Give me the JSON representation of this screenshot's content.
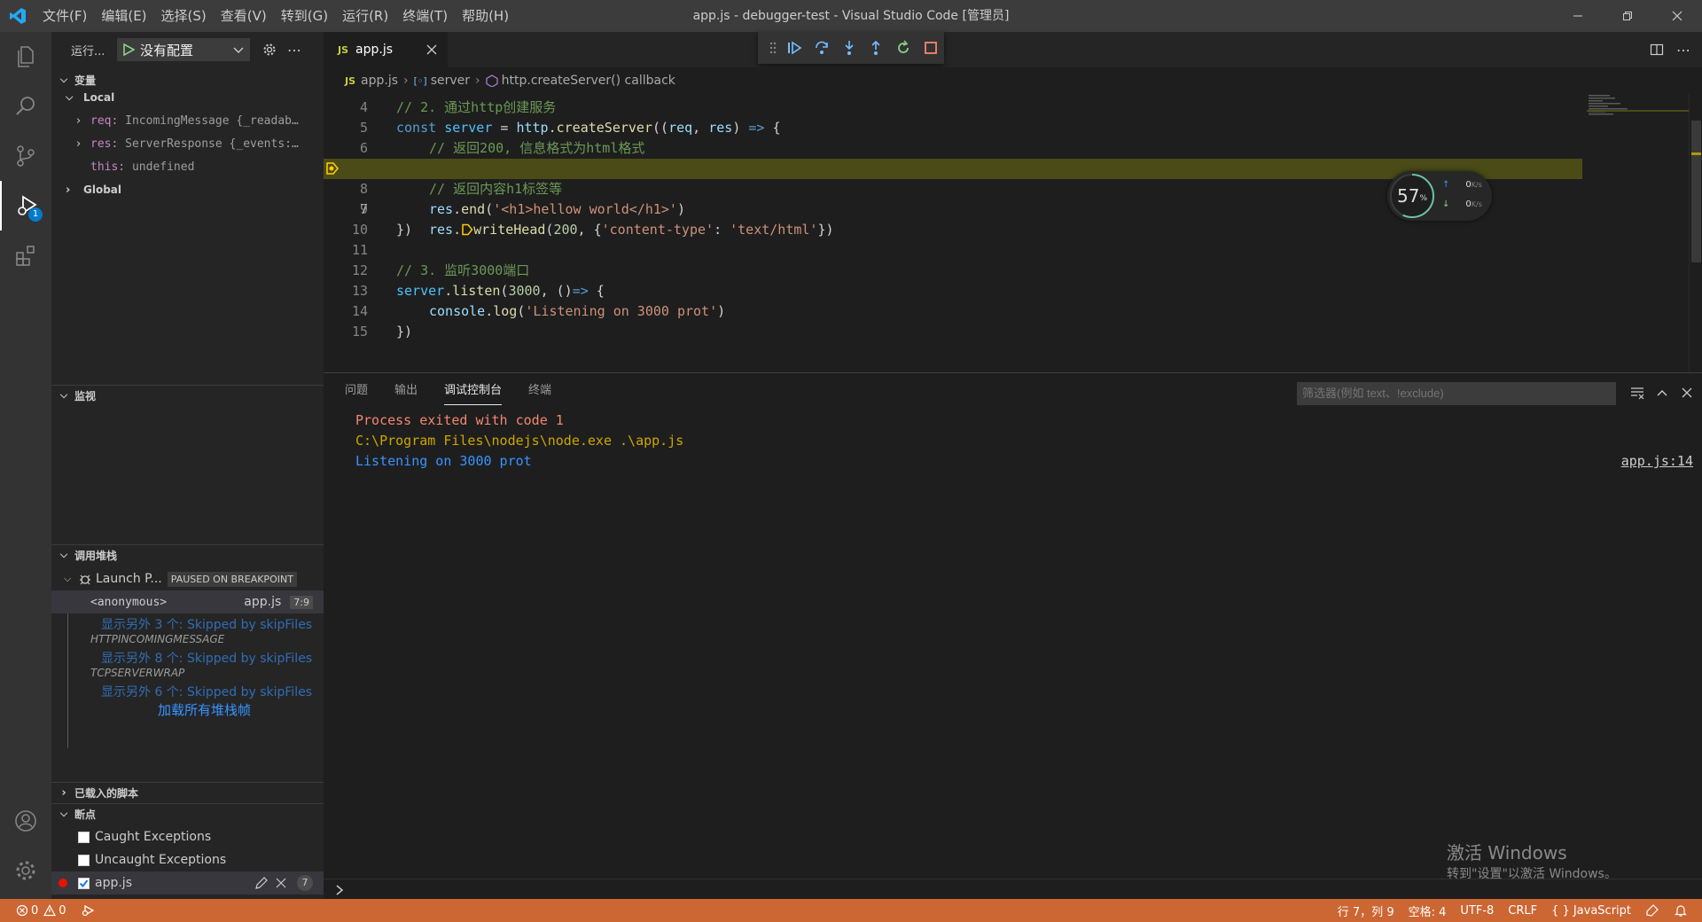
{
  "titlebar": {
    "title": "app.js - debugger-test - Visual Studio Code [管理员]",
    "menus": [
      "文件(F)",
      "编辑(E)",
      "选择(S)",
      "查看(V)",
      "转到(G)",
      "运行(R)",
      "终端(T)",
      "帮助(H)"
    ]
  },
  "activity": {
    "debug_badge": "1"
  },
  "sidebar": {
    "run_label": "运行...",
    "config_name": "没有配置",
    "variables": {
      "header": "变量",
      "local_header": "Local",
      "items": [
        {
          "name": "req:",
          "value": "IncomingMessage {_readab…"
        },
        {
          "name": "res:",
          "value": "ServerResponse {_events:…"
        },
        {
          "name": "this:",
          "value": "undefined"
        }
      ],
      "global_header": "Global"
    },
    "watch": {
      "header": "监视"
    },
    "callstack": {
      "header": "调用堆栈",
      "session": "Launch P...",
      "session_state": "PAUSED ON BREAKPOINT",
      "frame": {
        "name": "<anonymous>",
        "file": "app.js",
        "pos": "7:9"
      },
      "skipped": [
        {
          "text": "显示另外 3 个: Skipped by skipFiles",
          "name": "HTTPINCOMINGMESSAGE"
        },
        {
          "text": "显示另外 8 个: Skipped by skipFiles",
          "name": "TCPSERVERWRAP"
        },
        {
          "text": "显示另外 6 个: Skipped by skipFiles",
          "name": ""
        }
      ],
      "load_all": "加载所有堆栈帧"
    },
    "loaded_scripts": {
      "header": "已载入的脚本"
    },
    "breakpoints": {
      "header": "断点",
      "items": [
        {
          "label": "Caught Exceptions",
          "checked": false
        },
        {
          "label": "Uncaught Exceptions",
          "checked": false
        }
      ],
      "file": {
        "label": "app.js",
        "line": "7"
      }
    }
  },
  "editor": {
    "tab_icon": "JS",
    "tab_label": "app.js",
    "breadcrumb": [
      "app.js",
      "server",
      "http.createServer() callback"
    ],
    "lines": [
      {
        "n": "4"
      },
      {
        "n": "5"
      },
      {
        "n": "6"
      },
      {
        "n": "7"
      },
      {
        "n": "8"
      },
      {
        "n": "9"
      },
      {
        "n": "10"
      },
      {
        "n": "11"
      },
      {
        "n": "12"
      },
      {
        "n": "13"
      },
      {
        "n": "14"
      },
      {
        "n": "15"
      }
    ],
    "code": {
      "l4": "// 2. 通过http创建服务",
      "l5_kw": "const",
      "l5_var": "server",
      "l5_eq": " = ",
      "l5_obj": "http",
      "l5_fn": "createServer",
      "l5_rest1": "((",
      "l5_a1": "req",
      "l5_c": ", ",
      "l5_a2": "res",
      "l5_rest2": ") ",
      "l5_arrow": "=>",
      "l5_rest3": " {",
      "l6": "// 返回200, 信息格式为html格式",
      "l7_obj": "res",
      "l7_dot": ".",
      "l7_fn": "writeHead",
      "l7_p1": "(",
      "l7_num": "200",
      "l7_p2": ", {",
      "l7_s1": "'content-type'",
      "l7_p3": ": ",
      "l7_s2": "'text/html'",
      "l7_p4": "})",
      "l8": "// 返回内容h1标签等",
      "l9_obj": "res",
      "l9_dot": ".",
      "l9_fn": "end",
      "l9_p1": "(",
      "l9_s": "'<h1>hellow world</h1>'",
      "l9_p2": ")",
      "l10": "})",
      "l12": "// 3. 监听3000端口",
      "l13_obj": "server",
      "l13_dot": ".",
      "l13_fn": "listen",
      "l13_p1": "(",
      "l13_num": "3000",
      "l13_p2": ", ()",
      "l13_arrow": "=>",
      "l13_p3": " {",
      "l14_obj": "console",
      "l14_dot": ".",
      "l14_fn": "log",
      "l14_p1": "(",
      "l14_s": "'Listening on 3000 prot'",
      "l14_p2": ")",
      "l15": "})"
    }
  },
  "net_widget": {
    "percent": "57",
    "unit": "%",
    "up": "0",
    "down": "0",
    "rate_unit": "K/s",
    "ring_fraction": 0.57
  },
  "panel": {
    "tabs": [
      "问题",
      "输出",
      "调试控制台",
      "终端"
    ],
    "filter_placeholder": "筛选器(例如 text、!exclude)",
    "console": [
      {
        "text": "Process exited with code 1",
        "color": "#f48771"
      },
      {
        "text": "C:\\Program Files\\nodejs\\node.exe .\\app.js",
        "color": "#cca700"
      },
      {
        "text": "Listening on 3000 prot",
        "color": "#3794ff"
      }
    ],
    "source_link": "app.js:14"
  },
  "activation": {
    "line1": "激活 Windows",
    "line2": "转到\"设置\"以激活 Windows。"
  },
  "statusbar": {
    "errors": "0",
    "warnings": "0",
    "position": "行 7，列 9",
    "spaces": "空格: 4",
    "encoding": "UTF-8",
    "eol": "CRLF",
    "language": "JavaScript",
    "bg_color": "#cc6633"
  }
}
